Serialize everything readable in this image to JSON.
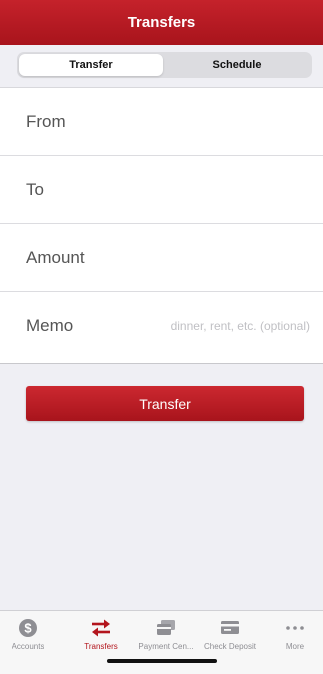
{
  "header": {
    "title": "Transfers"
  },
  "segments": {
    "transfer": "Transfer",
    "schedule": "Schedule"
  },
  "form": {
    "from_label": "From",
    "to_label": "To",
    "amount_label": "Amount",
    "memo_label": "Memo",
    "memo_placeholder": "dinner, rent, etc. (optional)",
    "memo_value": ""
  },
  "actions": {
    "transfer_label": "Transfer"
  },
  "tabbar": {
    "items": [
      {
        "label": "Accounts",
        "icon": "dollar-circle-icon"
      },
      {
        "label": "Transfers",
        "icon": "arrows-swap-icon"
      },
      {
        "label": "Payment Cen...",
        "icon": "cards-icon"
      },
      {
        "label": "Check Deposit",
        "icon": "check-icon"
      },
      {
        "label": "More",
        "icon": "ellipsis-icon"
      }
    ],
    "active_index": 1
  },
  "colors": {
    "brand": "#b3151d",
    "inactive": "#8e8e93"
  }
}
